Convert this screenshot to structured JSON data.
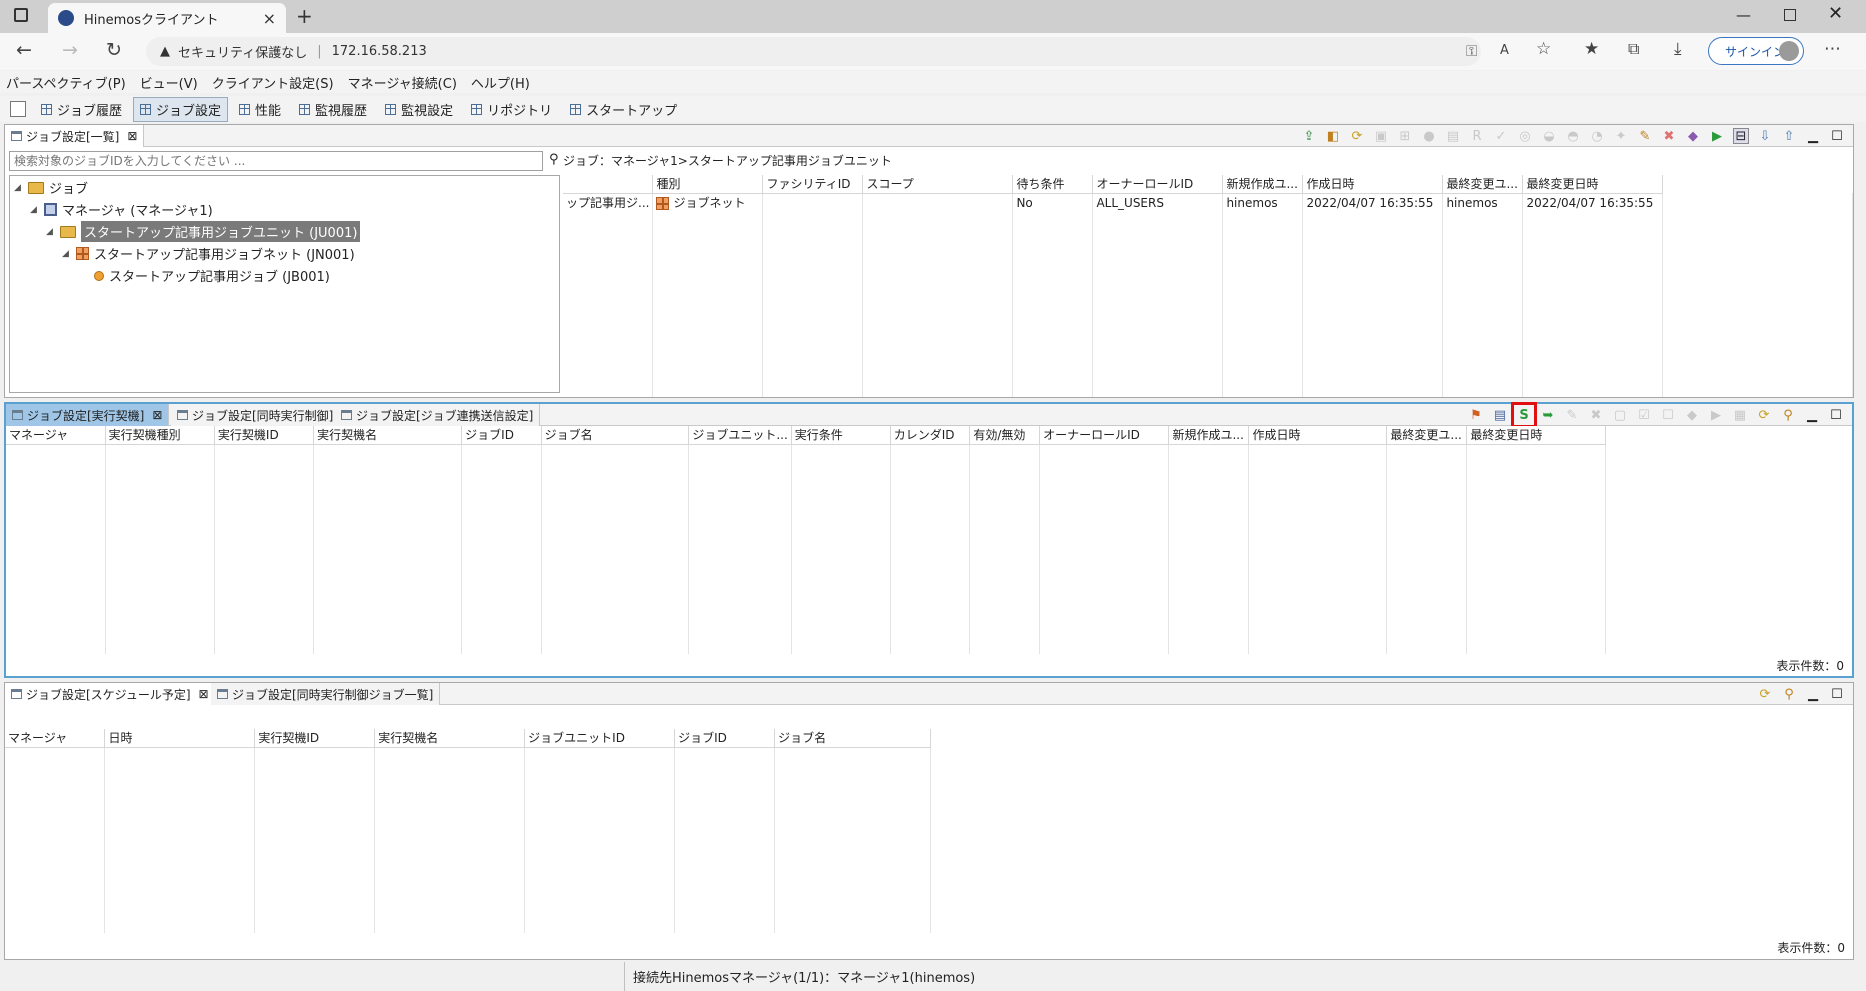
{
  "browser": {
    "tab_title": "Hinemosクライアント",
    "security_label": "セキュリティ保護なし",
    "url": "172.16.58.213",
    "signin_label": "サインイン"
  },
  "menu": [
    "パースペクティブ(P)",
    "ビュー(V)",
    "クライアント設定(S)",
    "マネージャ接続(C)",
    "ヘルプ(H)"
  ],
  "perspectives": [
    "ジョブ履歴",
    "ジョブ設定",
    "性能",
    "監視履歴",
    "監視設定",
    "リポジトリ",
    "スタートアップ"
  ],
  "job_list_panel": {
    "tab": "ジョブ設定[一覧]",
    "search_placeholder": "検索対象のジョブIDを入力してください ...",
    "breadcrumb": "ジョブ：マネージャ1>スタートアップ記事用ジョブユニット",
    "tree": {
      "root": "ジョブ",
      "manager": "マネージャ (マネージャ1)",
      "unit": "スタートアップ記事用ジョブユニット (JU001)",
      "net": "スタートアップ記事用ジョブネット (JN001)",
      "job": "スタートアップ記事用ジョブ (JB001)"
    },
    "columns": [
      "",
      "種別",
      "ファシリティID",
      "スコープ",
      "待ち条件",
      "オーナーロールID",
      "新規作成ユ...",
      "作成日時",
      "最終変更ユ...",
      "最終変更日時"
    ],
    "rows": [
      [
        "ップ記事用ジ...",
        "ジョブネット",
        "",
        "",
        "No",
        "ALL_USERS",
        "hinemos",
        "2022/04/07 16:35:55",
        "hinemos",
        "2022/04/07 16:35:55"
      ]
    ]
  },
  "kick_panel": {
    "tabs": [
      "ジョブ設定[実行契機]",
      "ジョブ設定[同時実行制御]",
      "ジョブ設定[ジョブ連携送信設定]"
    ],
    "columns": [
      "マネージャ",
      "実行契機種別",
      "実行契機ID",
      "実行契機名",
      "ジョブID",
      "ジョブ名",
      "ジョブユニット...",
      "実行条件",
      "カレンダID",
      "有効/無効",
      "オーナーロールID",
      "新規作成ユ...",
      "作成日時",
      "最終変更ユ...",
      "最終変更日時"
    ],
    "count_label": "表示件数：0"
  },
  "schedule_panel": {
    "tabs": [
      "ジョブ設定[スケジュール予定]",
      "ジョブ設定[同時実行制御ジョブ一覧]"
    ],
    "columns": [
      "マネージャ",
      "日時",
      "実行契機ID",
      "実行契機名",
      "ジョブユニットID",
      "ジョブID",
      "ジョブ名"
    ],
    "count_label": "表示件数：0"
  },
  "status": {
    "text": "接続先Hinemosマネージャ(1/1)：マネージャ1(hinemos)"
  },
  "colors": {
    "highlight": "#e01010",
    "active_tab": "#9fc6e6"
  }
}
